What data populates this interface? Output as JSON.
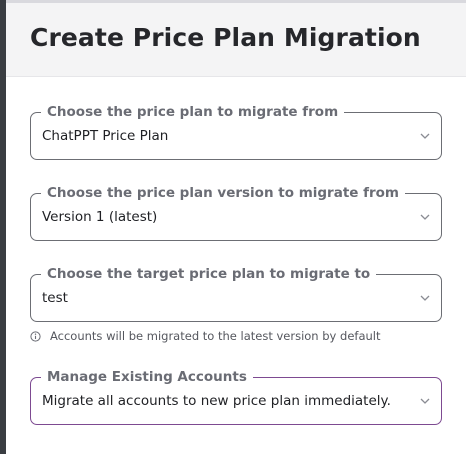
{
  "title": "Create Price Plan Migration",
  "fields": [
    {
      "label": "Choose the price plan to migrate from",
      "value": "ChatPPT Price Plan"
    },
    {
      "label": "Choose the price plan version to migrate from",
      "value": "Version 1 (latest)"
    },
    {
      "label": "Choose the target price plan to migrate to",
      "value": "test"
    },
    {
      "label": "Manage Existing Accounts",
      "value": "Migrate all accounts to new price plan immediately."
    }
  ],
  "hint": "Accounts will be migrated to the latest version by default",
  "colors": {
    "accent_border": "#7d4a91",
    "field_border": "#6c6e74",
    "header_bg": "#f4f4f5"
  },
  "icons": {
    "dropdown": "chevron-down-icon",
    "hint": "info-icon"
  }
}
